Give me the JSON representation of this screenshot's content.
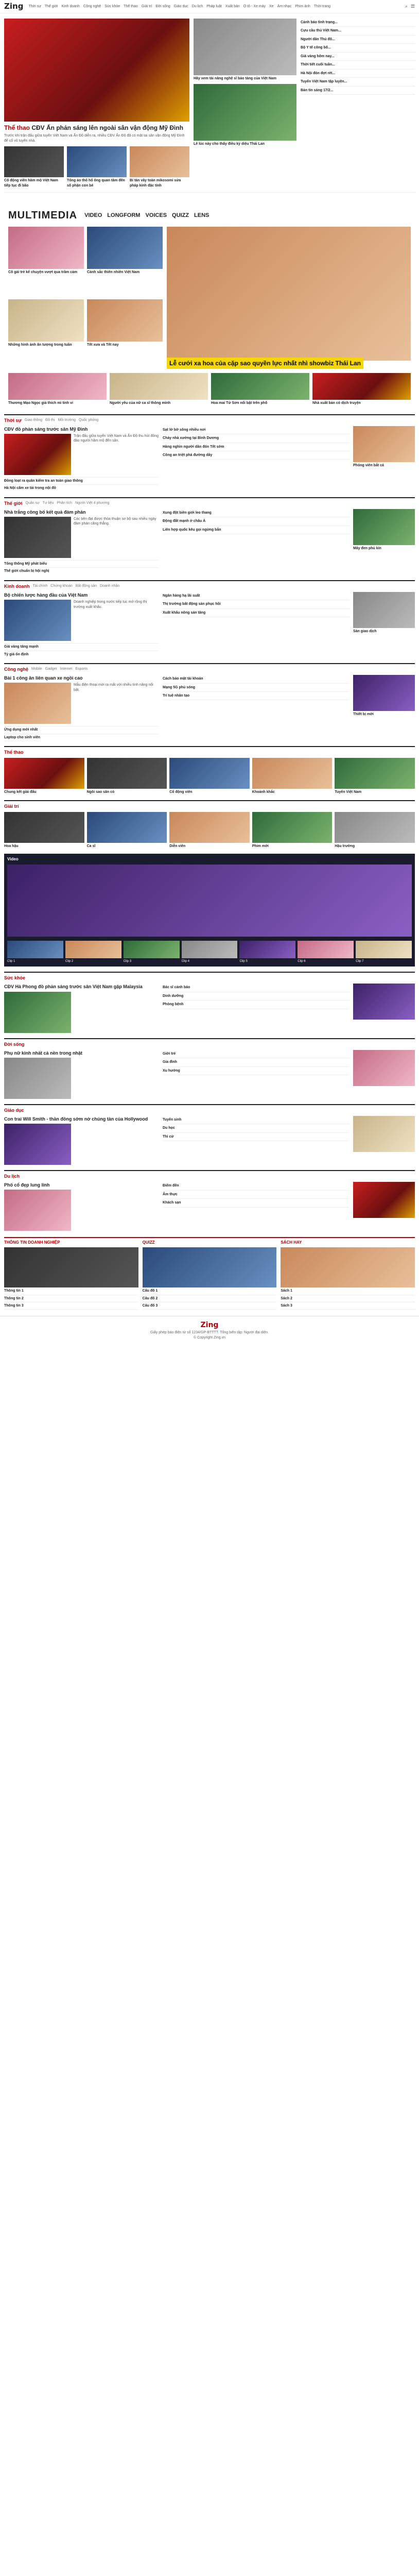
{
  "header": {
    "logo_main": "Zing",
    "logo_sub": "news",
    "nav": [
      "Thời sự",
      "Thế giới",
      "Kinh doanh",
      "Công nghệ",
      "Sức khỏe",
      "Thể thao",
      "Giải trí",
      "Đời sống",
      "Giáo dục",
      "Du lịch",
      "Pháp luật",
      "Xuất bản",
      "Ô tô - Xe máy",
      "Xe",
      "Âm nhạc",
      "Phim ảnh",
      "Thời trang"
    ]
  },
  "hero": {
    "main_tag": "Thể thao",
    "main_title": "CĐV Ấn phản sáng lên ngoài sân vận động Mỹ Đình",
    "main_sapo": "Trước khi trận đấu giữa tuyển Việt Nam và Ấn Độ diễn ra, nhiều CĐV Ấn Độ đã có mặt tại sân vận động Mỹ Đình để cổ vũ tuyển nhà.",
    "sub": [
      "Cổ động viên hâm mộ Việt Nam tiếp tục đi bão",
      "Tổng ảo thổ hổ ông quan tâm đến số phận con bé",
      "Bí tán vây toàn mikosomi sửa pháp kinh đặc tính"
    ],
    "col2": [
      "Hãy xem tài năng nghệ sĩ bảo tàng của Việt Nam",
      "Lê lúc này cho thấy điều kỳ diệu Thái Lan"
    ],
    "side": [
      "Cảnh báo tình trạng...",
      "Cựu cầu thủ Việt Nam...",
      "Người dân Thủ đô...",
      "Bộ Y tế công bố...",
      "Giá vàng hôm nay...",
      "Thời tiết cuối tuần...",
      "Hà Nội đón đợt rét...",
      "Tuyển Việt Nam tập luyện...",
      "Bản tin sáng 17/2..."
    ]
  },
  "multimedia": {
    "title": "MULTIMEDIA",
    "tabs": [
      "VIDEO",
      "LONGFORM",
      "VOICES",
      "QUIZZ",
      "LENS"
    ],
    "left": [
      "Cô gái trẻ kể chuyện vượt qua trầm cảm",
      "Cảnh sắc thiên nhiên Việt Nam",
      "Những hình ảnh ấn tượng trong tuần",
      "Tết xưa và Tết nay"
    ],
    "big_caption": "Lễ cưới xa hoa của cặp sao quyền lực nhất nhì showbiz Thái Lan",
    "bottom": [
      "Thương Mạo Ngọc giả thích mì tinh vi",
      "Người yêu của nữ ca sĩ thông minh",
      "Hoa mai Tứ Sơn nổi bật trên phố",
      "Nhà xuất bản có dịch truyện"
    ]
  },
  "categories": [
    {
      "name": "Thời sự",
      "tags": [
        "Giao thông",
        "Đô thị",
        "Môi trường",
        "Quốc phòng"
      ],
      "main": "CĐV đồ phản sáng trước sân Mỹ Đình",
      "sapo": "Trận đấu giữa tuyển Việt Nam và Ấn Độ thu hút đông đảo người hâm mộ đến sân.",
      "subs": [
        "Đồng loạt ra quân kiểm tra an toàn giao thông",
        "Hà Nội cấm xe tải trong nội đô"
      ],
      "mid": [
        "Sạt lở bờ sông nhiều nơi",
        "Cháy nhà xưởng tại Bình Dương",
        "Hàng nghìn người dân đón Tết sớm",
        "Công an triệt phá đường dây"
      ],
      "right": "Phóng viên bắt cá"
    },
    {
      "name": "Thế giới",
      "tags": [
        "Quân sự",
        "Tư liệu",
        "Phân tích",
        "Người Việt 4 phương"
      ],
      "main": "Nhà trắng công bố kết quả đàm phán",
      "sapo": "Các bên đạt được thỏa thuận sơ bộ sau nhiều ngày đàm phán căng thẳng.",
      "subs": [
        "Tổng thống Mỹ phát biểu",
        "Thế giới chuẩn bị hội nghị"
      ],
      "mid": [
        "Xung đột biên giới leo thang",
        "Động đất mạnh ở châu Á",
        "Liên hợp quốc kêu gọi ngừng bắn"
      ],
      "right": "Mây đen phủ kín"
    },
    {
      "name": "Kinh doanh",
      "tags": [
        "Tài chính",
        "Chứng khoán",
        "Bất động sản",
        "Doanh nhân"
      ],
      "main": "Bộ chiến lược hàng đầu của Việt Nam",
      "sapo": "Doanh nghiệp trong nước tiếp tục mở rộng thị trường xuất khẩu.",
      "subs": [
        "Giá vàng tăng mạnh",
        "Tỷ giá ổn định"
      ],
      "mid": [
        "Ngân hàng hạ lãi suất",
        "Thị trường bất động sản phục hồi",
        "Xuất khẩu nông sản tăng"
      ],
      "right": "Sàn giao dịch"
    },
    {
      "name": "Công nghệ",
      "tags": [
        "Mobile",
        "Gadget",
        "Internet",
        "Esports"
      ],
      "main": "Bài 1 công ăn liên quan xe ngồi cao",
      "sapo": "Mẫu điện thoại mới ra mắt với nhiều tính năng nổi bật.",
      "subs": [
        "Ứng dụng mới nhất",
        "Laptop cho sinh viên"
      ],
      "mid": [
        "Cách bảo mật tài khoản",
        "Mạng 5G phủ sóng",
        "Trí tuệ nhân tạo"
      ],
      "right": "Thiết bị mới"
    }
  ],
  "gallery_sections": [
    {
      "name": "Thể thao",
      "items": [
        "Chung kết giải đấu",
        "Ngôi sao sân cỏ",
        "Cổ động viên",
        "Khoảnh khắc",
        "Tuyển Việt Nam"
      ]
    },
    {
      "name": "Giải trí",
      "items": [
        "Hoa hậu",
        "Ca sĩ",
        "Diễn viên",
        "Phim mới",
        "Hậu trường"
      ]
    }
  ],
  "video": {
    "title": "Video",
    "items": [
      "Clip 1",
      "Clip 2",
      "Clip 3",
      "Clip 4",
      "Clip 5",
      "Clip 6",
      "Clip 7"
    ]
  },
  "more_categories": [
    {
      "name": "Sức khỏe",
      "main": "CĐV Hà Phong đồ phản sáng trước sân Việt Nam gặp Malaysia",
      "mid": [
        "Bác sĩ cảnh báo",
        "Dinh dưỡng",
        "Phòng bệnh"
      ]
    },
    {
      "name": "Đời sống",
      "main": "Phụ nữ kinh nhất cả nền trong nhật",
      "mid": [
        "Giới trẻ",
        "Gia đình",
        "Xu hướng"
      ]
    },
    {
      "name": "Giáo dục",
      "main": "Con trai Will Smith - thần đồng sớm nở chúng tàn của Hollywood",
      "mid": [
        "Tuyển sinh",
        "Du học",
        "Thi cử"
      ]
    },
    {
      "name": "Du lịch",
      "main": "Phố cổ đẹp lung linh",
      "mid": [
        "Điểm đến",
        "Ẩm thực",
        "Khách sạn"
      ]
    }
  ],
  "bottom": {
    "cols": [
      {
        "title": "THÔNG TIN DOANH NGHIỆP",
        "items": [
          "Thông tin 1",
          "Thông tin 2",
          "Thông tin 3"
        ]
      },
      {
        "title": "QUIZZ",
        "items": [
          "Câu đố 1",
          "Câu đố 2",
          "Câu đố 3"
        ]
      },
      {
        "title": "SÁCH HAY",
        "items": [
          "Sách 1",
          "Sách 2",
          "Sách 3"
        ]
      }
    ]
  },
  "footer": {
    "logo": "Zing",
    "text": "Giấy phép báo điện tử số 1234/GP-BTTTT. Tổng biên tập: Người đại diện.",
    "copy": "© Copyright Zing.vn"
  }
}
